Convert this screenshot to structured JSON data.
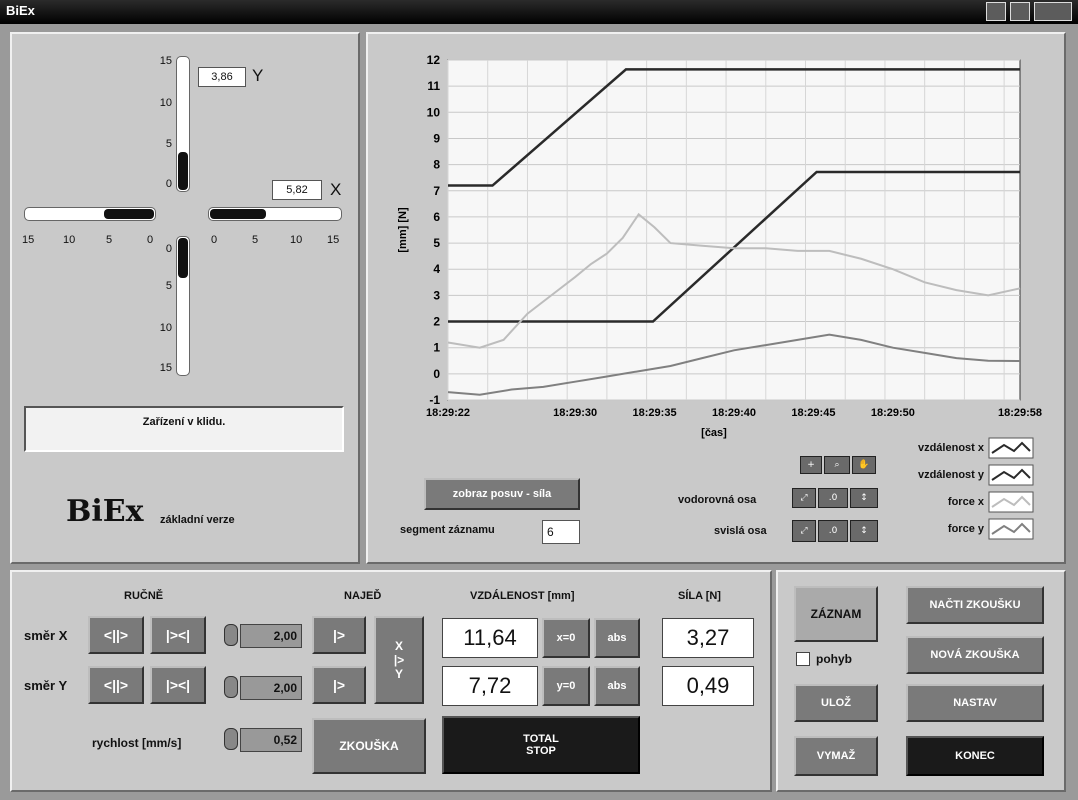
{
  "window": {
    "title": "BiEx"
  },
  "left": {
    "y_value": "3,86",
    "y_label": "Y",
    "x_value": "5,82",
    "x_label": "X",
    "y_ticks_top": [
      "15",
      "10",
      "5",
      "0"
    ],
    "y_ticks_bottom": [
      "0",
      "5",
      "10",
      "15"
    ],
    "x_ticks_left": [
      "15",
      "10",
      "5",
      "0"
    ],
    "x_ticks_right": [
      "0",
      "5",
      "10",
      "15"
    ],
    "status": "Zařízení v klidu.",
    "brand": "BiEx",
    "brand_sub": "základní verze"
  },
  "chart_data": {
    "type": "line",
    "xlabel": "[čas]",
    "ylabel": "[mm] [N]",
    "ylim": [
      -1,
      12
    ],
    "y_ticks": [
      "12",
      "11",
      "10",
      "9",
      "8",
      "7",
      "6",
      "5",
      "4",
      "3",
      "2",
      "1",
      "0",
      "-1"
    ],
    "x_ticks": [
      "18:29:22",
      "18:29:30",
      "18:29:35",
      "18:29:40",
      "18:29:45",
      "18:29:50",
      "18:29:58"
    ],
    "x_tick_seconds": [
      22,
      30,
      35,
      40,
      45,
      50,
      58
    ],
    "xlim_seconds": [
      22,
      58
    ],
    "grid": true,
    "legend_placement": "right-below-plot",
    "series": [
      {
        "name": "vzdálenost x",
        "color": "#2a2a2a",
        "x": [
          22,
          24.8,
          33.2,
          58
        ],
        "y": [
          7.2,
          7.2,
          11.64,
          11.64
        ]
      },
      {
        "name": "vzdálenost y",
        "color": "#2a2a2a",
        "x": [
          22,
          34.9,
          45.2,
          58
        ],
        "y": [
          2.0,
          2.0,
          7.72,
          7.72
        ]
      },
      {
        "name": "force x",
        "color": "#bdbdbd",
        "x": [
          22,
          24,
          25.5,
          27,
          28.5,
          30,
          31,
          32,
          33,
          34,
          35,
          36,
          38,
          40,
          42,
          44,
          46,
          48,
          50,
          52,
          54,
          56,
          58
        ],
        "y": [
          1.2,
          1.0,
          1.3,
          2.3,
          3.0,
          3.7,
          4.2,
          4.6,
          5.2,
          6.1,
          5.6,
          5.0,
          4.9,
          4.8,
          4.8,
          4.7,
          4.7,
          4.4,
          4.0,
          3.5,
          3.2,
          3.0,
          3.27
        ]
      },
      {
        "name": "force y",
        "color": "#808080",
        "x": [
          22,
          24,
          26,
          28,
          30,
          32,
          34,
          36,
          38,
          40,
          42,
          44,
          46,
          48,
          50,
          52,
          54,
          56,
          58
        ],
        "y": [
          -0.7,
          -0.8,
          -0.6,
          -0.5,
          -0.3,
          -0.1,
          0.1,
          0.3,
          0.6,
          0.9,
          1.1,
          1.3,
          1.5,
          1.3,
          1.0,
          0.8,
          0.6,
          0.5,
          0.49
        ]
      }
    ]
  },
  "chart_controls": {
    "zobraz_button": "zobraz posuv - síla",
    "segment_label": "segment záznamu",
    "segment_value": "6",
    "horizontal_axis_label": "vodorovná osa",
    "vertical_axis_label": "svislá osa"
  },
  "bottom": {
    "rucne_header": "RUČNĚ",
    "najed_header": "NAJEĎ",
    "vzdalenost_header": "VZDÁLENOST [mm]",
    "sila_header": "SÍLA [N]",
    "smer_x_label": "směr X",
    "smer_y_label": "směr Y",
    "rychlost_label": "rychlost [mm/s]",
    "apart_button": "<||>",
    "together_button": "|><|",
    "speed_x": "2,00",
    "speed_y": "2,00",
    "rychlost": "0,52",
    "najed_x_button": "|>",
    "najed_y_button": "|>",
    "xy_button_1": "X",
    "xy_button_2": "|>",
    "xy_button_3": "Y",
    "zkouska_button": "ZKOUŠKA",
    "distance_x": "11,64",
    "distance_y": "7,72",
    "zero_x_button": "x=0",
    "zero_y_button": "y=0",
    "abs_button": "abs",
    "force_x": "3,27",
    "force_y": "0,49",
    "total_stop_1": "TOTAL",
    "total_stop_2": "STOP"
  },
  "right_controls": {
    "zaznam_button": "ZÁZNAM",
    "pohyb_label": "pohyb",
    "nacti_button": "NAČTI ZKOUŠKU",
    "nova_button": "NOVÁ ZKOUŠKA",
    "uloz_button": "ULOŽ",
    "nastav_button": "NASTAV",
    "vymaz_button": "VYMAŽ",
    "konec_button": "KONEC"
  }
}
